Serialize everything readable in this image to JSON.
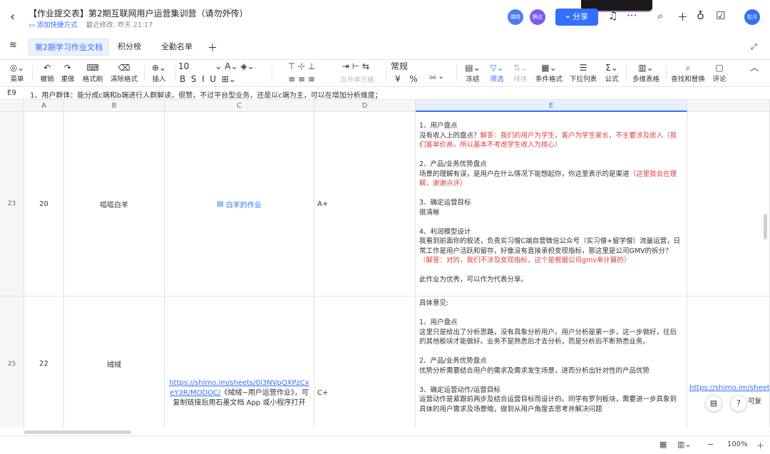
{
  "header": {
    "back_icon": "chevron-left-icon",
    "title": "【作业提交表】第2期互联网用户运营集训营（请勿外传）",
    "add_shortcut": "添加快捷方式",
    "last_modified": "最近修改: 昨天 21:17",
    "collaborators": [
      {
        "name": "晓晓",
        "color": "#4e7cf0"
      },
      {
        "name": "腾达",
        "color": "#7b5cf0"
      }
    ],
    "share_label": "分享",
    "user_avatar": "松月",
    "accent_color": "#3370ff"
  },
  "tabs": {
    "items": [
      "第2期学习作业文档",
      "积分榜",
      "全勤名单"
    ],
    "active_index": 0,
    "add_icon": "plus-icon"
  },
  "toolbar": {
    "menu": "菜单",
    "undo": "撤销",
    "redo": "重做",
    "format_painter": "格式刷",
    "clear_format": "清除格式",
    "insert": "插入",
    "font_size": "10",
    "merge_cells": "合并单元格",
    "number_format": "常规",
    "currency": "¥",
    "percent": "%",
    "freeze": "冻结",
    "filter": "筛选",
    "sort": "排序",
    "conditional_format": "条件格式",
    "dropdown_list": "下拉列表",
    "formula": "公式",
    "multi_dim_table": "多维表格",
    "find_replace": "查找和替换",
    "comment": "评论"
  },
  "formula_bar": {
    "cell_ref": "E9",
    "value": "1、用户群体：能分成c端和b端进行人群解读，很赞，不过平台型业务，还是以c端为主，可以在增加分析维度；"
  },
  "grid": {
    "columns": [
      "A",
      "B",
      "C",
      "D",
      "E"
    ],
    "rows": [
      {
        "row_number": "23",
        "a": "20",
        "b": "呱呱白羊",
        "c_link": "白羊的作业",
        "d": "A+",
        "e_lines": [
          {
            "t": "1、用户盘点"
          },
          {
            "t": "没有收入上的盘点？",
            "r": "解答：我们的用户为学生，客户为学生家长，不主要涉及收入（我们客单价高，所以基本不考虑学生收入为核心）"
          },
          {
            "t": ""
          },
          {
            "t": "2、产品/业务优势盘点"
          },
          {
            "t": "场景的理解有误，是用户在什么情况下能想起你，你这里表示的是渠道",
            "r": "（这里我会在理解，谢谢点评）"
          },
          {
            "t": ""
          },
          {
            "t": "3、确定运营目标"
          },
          {
            "t": "很清晰"
          },
          {
            "t": ""
          },
          {
            "t": "4、利润模型设计"
          },
          {
            "t": "我看到前面你的叙述，负责实习僧C端自营微信公众号（实习僧+留学僧）流量运营，日常工作是用户活跃和留存，好像没有直接承担变现指标，那这里是公司GMV的拆分？",
            "r": "（解答：对的，我们不涉及变现指标，这个是根据公司gmv来计算的）"
          },
          {
            "t": ""
          },
          {
            "t": "此作业为优秀，可以作为代表分享。"
          }
        ]
      },
      {
        "row_number": "25",
        "a": "22",
        "b": "绒绒",
        "c_url": "https://shimo.im/sheets/0l3NVpQXPzCxeY3R/MODOC/",
        "c_text": "《绒绒~用户运营作业》，可复制链接后用石墨文档 App 或小程序打开",
        "d": "C+",
        "e_lines": [
          {
            "t": "具体意见:"
          },
          {
            "t": ""
          },
          {
            "t": "1、用户盘点"
          },
          {
            "t": "这里只是给出了分析思路，没有具象分析用户。用户分析是第一步，这一步做好，往后的其他板块才能做好。业务不是熟悉后才去分析，而是分析后不断熟悉业务。"
          },
          {
            "t": ""
          },
          {
            "t": "2、产品/业务优势盘点"
          },
          {
            "t": " 优势分析需要结合用户的需求及需求发生场景，进而分析出针对性的产品优势"
          },
          {
            "t": ""
          },
          {
            "t": "3、确定运营动作/运营目标"
          },
          {
            "t": "运营动作是紧跟前两步及结合运营目标而设计的。同学有罗列板块，需要进一步具象到具体的用户需求及场景哦，做到从用户角度去思考并解决问题"
          }
        ],
        "f_link": "https://shimo.im/sheets",
        "f_suffix": "可复"
      }
    ]
  },
  "status_bar": {
    "zoom": "100%"
  }
}
